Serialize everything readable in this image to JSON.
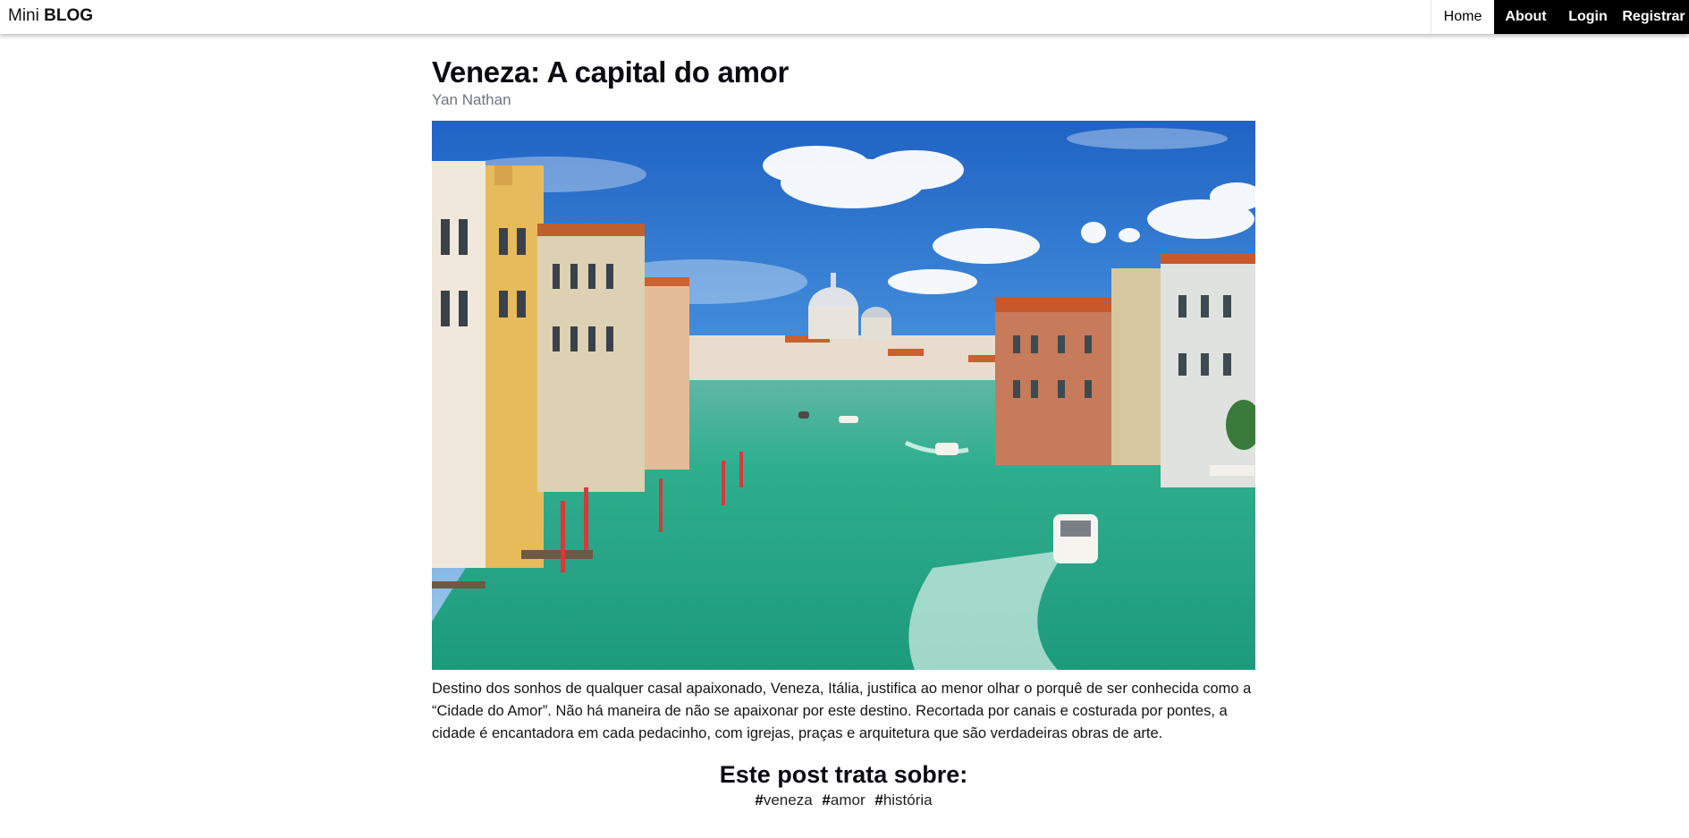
{
  "navbar": {
    "brand_light": "Mini",
    "brand_bold": "BLOG",
    "links": [
      {
        "label": "Home",
        "active": true
      },
      {
        "label": "About",
        "active": false
      },
      {
        "label": "Login",
        "active": false
      },
      {
        "label": "Registrar",
        "active": false
      }
    ]
  },
  "post": {
    "title": "Veneza: A capital do amor",
    "author": "Yan Nathan",
    "image_icon": "venice-grand-canal-photo",
    "body": "Destino dos sonhos de qualquer casal apaixonado, Veneza, Itália, justifica ao menor olhar o porquê de ser conhecida como a “Cidade do Amor”. Não há maneira de não se apaixonar por este destino. Recortada por canais e costurada por pontes, a cidade é encantadora em cada pedacinho, com igrejas, praças e arquitetura que são verdadeiras obras de arte.",
    "tags_title": "Este post trata sobre:",
    "tags": [
      {
        "hash": "#",
        "name": "veneza"
      },
      {
        "hash": "#",
        "name": "amor"
      },
      {
        "hash": "#",
        "name": "história"
      }
    ]
  },
  "colors": {
    "nav_active_bg": "#ffffff",
    "nav_bg": "#000000",
    "author_text": "#6f7380",
    "water": "#2fae8e",
    "sky": "#3b7fd6"
  }
}
